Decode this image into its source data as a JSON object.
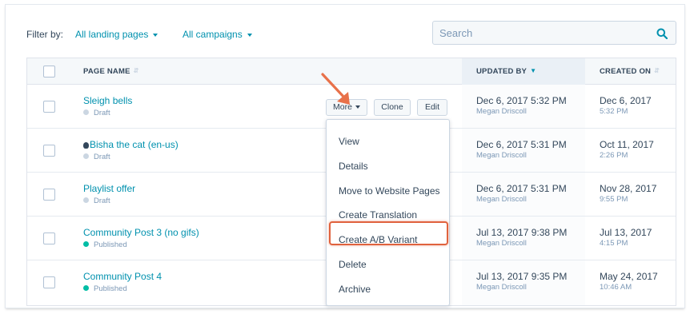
{
  "filters": {
    "label": "Filter by:",
    "landing_pages": "All landing pages",
    "campaigns": "All campaigns"
  },
  "search": {
    "placeholder": "Search",
    "icon": "search-icon"
  },
  "table": {
    "columns": {
      "page_name": "PAGE NAME",
      "updated_by": "UPDATED BY",
      "created_on": "CREATED ON"
    },
    "rows": [
      {
        "name": "Sleigh bells",
        "status": "Draft",
        "updated_date": "Dec 6, 2017 5:32 PM",
        "updated_by": "Megan Driscoll",
        "created_date": "Dec 6, 2017",
        "created_time": "5:32 PM"
      },
      {
        "name": "Bisha the cat (en-us)",
        "status": "Draft",
        "updated_date": "Dec 6, 2017 5:31 PM",
        "updated_by": "Megan Driscoll",
        "created_date": "Oct 11, 2017",
        "created_time": "2:26 PM"
      },
      {
        "name": "Playlist offer",
        "status": "Draft",
        "updated_date": "Dec 6, 2017 5:31 PM",
        "updated_by": "Megan Driscoll",
        "created_date": "Nov 28, 2017",
        "created_time": "9:55 PM"
      },
      {
        "name": "Community Post 3 (no gifs)",
        "status": "Published",
        "updated_date": "Jul 13, 2017 9:38 PM",
        "updated_by": "Megan Driscoll",
        "created_date": "Jul 13, 2017",
        "created_time": "4:15 PM"
      },
      {
        "name": "Community Post 4",
        "status": "Published",
        "updated_date": "Jul 13, 2017 9:35 PM",
        "updated_by": "Megan Driscoll",
        "created_date": "May 24, 2017",
        "created_time": "10:46 AM"
      }
    ]
  },
  "row_actions": {
    "more": "More",
    "clone": "Clone",
    "edit": "Edit"
  },
  "more_menu": {
    "items": [
      "View",
      "Details",
      "Move to Website Pages",
      "Create Translation",
      "Create A/B Variant",
      "Delete",
      "Archive"
    ],
    "highlighted_item": "Create A/B Variant"
  },
  "colors": {
    "link": "#0091ae",
    "text": "#33475b",
    "draft_dot": "#cbd6e2",
    "published_dot": "#00bda5",
    "highlight_border": "#e0623e"
  }
}
